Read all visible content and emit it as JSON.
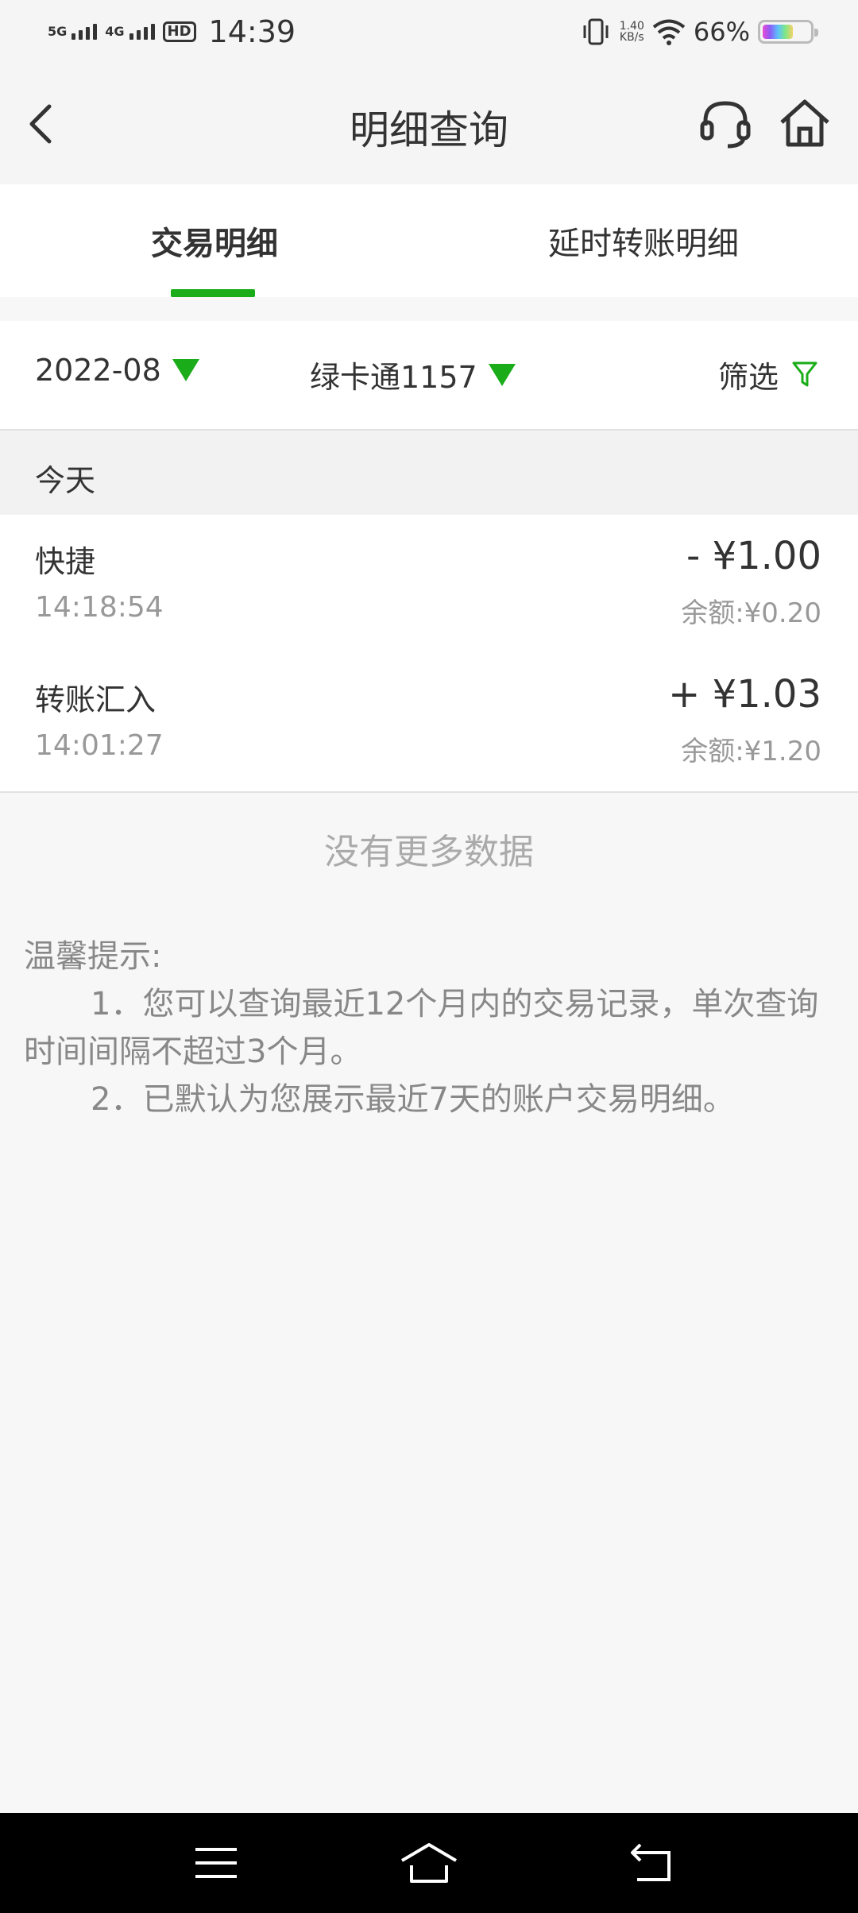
{
  "status_bar": {
    "sim1": "5G",
    "sim2": "4G",
    "hd": "HD",
    "time": "14:39",
    "net_speed_value": "1.40",
    "net_speed_unit": "KB/s",
    "battery": "66%",
    "battery_level": 0.66
  },
  "header": {
    "title": "明细查询"
  },
  "tabs": [
    {
      "label": "交易明细",
      "active": true
    },
    {
      "label": "延时转账明细",
      "active": false
    }
  ],
  "filters": {
    "date": "2022-08",
    "card": "绿卡通1157",
    "screen": "筛选"
  },
  "day_label": "今天",
  "transactions": [
    {
      "name": "快捷",
      "time": "14:18:54",
      "amount": "- ¥1.00",
      "balance": "余额:¥0.20"
    },
    {
      "name": "转账汇入",
      "time": "14:01:27",
      "amount": "+ ¥1.03",
      "balance": "余额:¥1.20"
    }
  ],
  "no_more": "没有更多数据",
  "tips": {
    "title": "温馨提示:",
    "items": [
      "1．您可以查询最近12个月内的交易记录，单次查询时间间隔不超过3个月。",
      "2．已默认为您展示最近7天的账户交易明细。"
    ]
  },
  "colors": {
    "accent": "#1aad19"
  }
}
